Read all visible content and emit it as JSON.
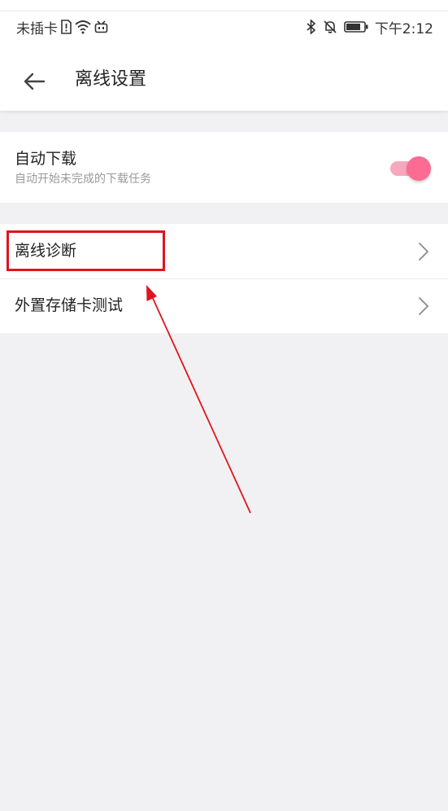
{
  "status_bar": {
    "carrier": "未插卡",
    "time": "下午2:12",
    "icons": [
      "sim-alert-icon",
      "wifi-icon",
      "tv-app-icon",
      "bluetooth-icon",
      "mute-icon",
      "battery-icon"
    ]
  },
  "header": {
    "back_icon": "back-arrow-icon",
    "title": "离线设置"
  },
  "auto_download": {
    "title": "自动下载",
    "subtitle": "自动开始未完成的下载任务",
    "enabled": true,
    "accent_color": "#fb6b94"
  },
  "links": [
    {
      "label": "离线诊断",
      "icon": "chevron-right-icon"
    },
    {
      "label": "外置存储卡测试",
      "icon": "chevron-right-icon"
    }
  ],
  "annotation": {
    "highlight_color": "#e0141c"
  }
}
